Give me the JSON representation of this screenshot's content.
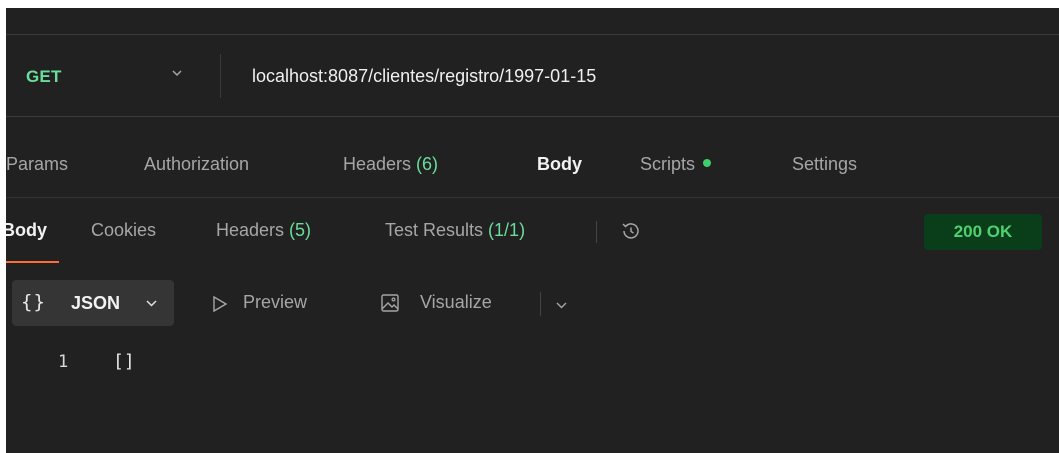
{
  "request": {
    "method": "GET",
    "url": "localhost:8087/clientes/registro/1997-01-15"
  },
  "request_tabs": [
    {
      "label": "Params"
    },
    {
      "label": "Authorization"
    },
    {
      "label": "Headers ",
      "count": "(6)"
    },
    {
      "label": "Body"
    },
    {
      "label": "Scripts"
    },
    {
      "label": "Settings"
    }
  ],
  "response_tabs": [
    {
      "label": "Body"
    },
    {
      "label": "Cookies"
    },
    {
      "label": "Headers ",
      "count": "(5)"
    },
    {
      "label": "Test Results ",
      "count": "(1/1)"
    }
  ],
  "status": "200 OK",
  "format": {
    "braces": "{}",
    "selected": "JSON",
    "preview": "Preview",
    "visualize": "Visualize"
  },
  "code": {
    "line_number": "1",
    "content": "[]"
  },
  "colors": {
    "accent": "#ff6c37",
    "method": "#6bdd9a",
    "status_text": "#4fd16f",
    "status_bg": "#0a3d1a",
    "background": "#212121"
  },
  "icons": {
    "method_dropdown": "chevron-down-icon",
    "history": "history-icon",
    "preview": "play-outline-icon",
    "visualize": "image-icon",
    "scripts_status": "green-dot-icon"
  }
}
